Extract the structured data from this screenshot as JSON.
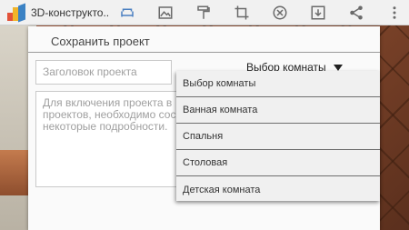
{
  "app": {
    "title": "3D-конструкто..",
    "icons": [
      "couch-icon",
      "image-icon",
      "paint-roller-icon",
      "crop-icon",
      "close-circle-icon",
      "download-icon",
      "share-icon",
      "overflow-menu-icon"
    ]
  },
  "dialog": {
    "title": "Сохранить проект",
    "title_placeholder": "Заголовок проекта",
    "description_placeholder": "Для включения проекта в\nпроектов, необходимо сос\nнекоторые подробности.",
    "room_select": {
      "selected": "Выбор комнаты"
    }
  },
  "dropdown": {
    "items": [
      "Выбор комнаты",
      "Ванная комната",
      "Спальня",
      "Столовая",
      "Детская комната"
    ]
  },
  "colors": {
    "accent": "#4a7fc1",
    "icon": "#6a6a6a"
  }
}
